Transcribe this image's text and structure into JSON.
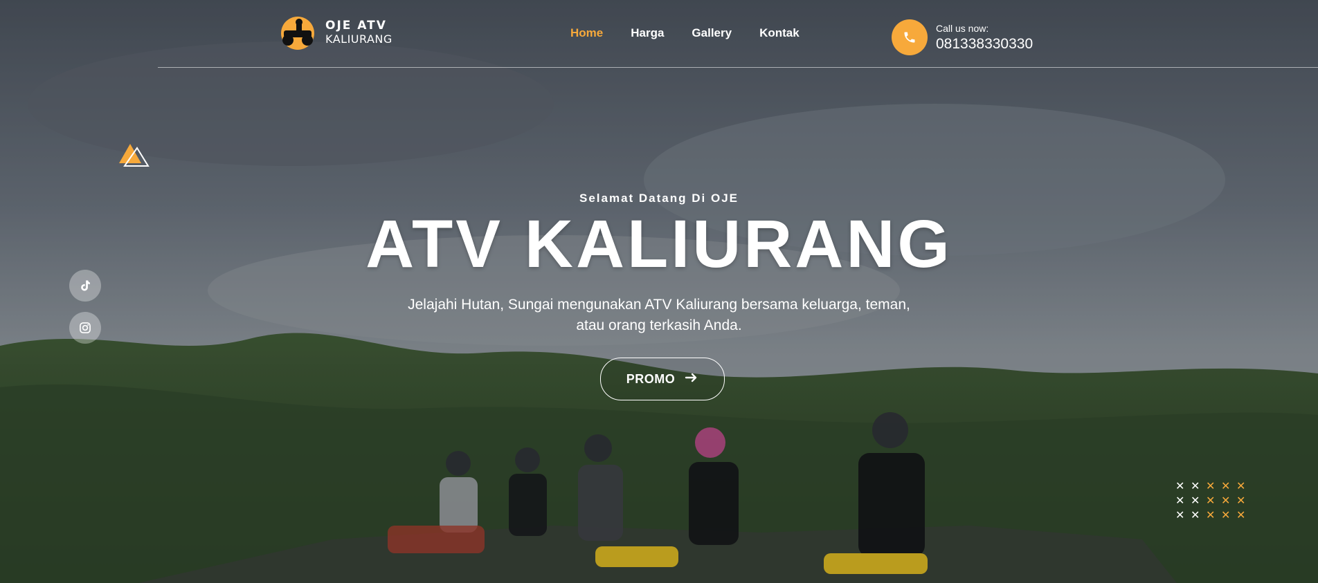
{
  "brand": {
    "name": "OJE ATV",
    "sub": "KALIURANG"
  },
  "nav": {
    "items": [
      {
        "label": "Home",
        "active": true
      },
      {
        "label": "Harga",
        "active": false
      },
      {
        "label": "Gallery",
        "active": false
      },
      {
        "label": "Kontak",
        "active": false
      }
    ]
  },
  "contact": {
    "label": "Call us now:",
    "phone": "081338330330",
    "icon": "phone-icon"
  },
  "socials": [
    {
      "icon": "tiktok-icon"
    },
    {
      "icon": "instagram-icon"
    }
  ],
  "hero": {
    "eyebrow": "Selamat Datang Di OJE",
    "title": "ATV KALIURANG",
    "subtitle": "Jelajahi Hutan, Sungai mengunakan ATV Kaliurang bersama keluarga, teman, atau orang terkasih Anda.",
    "cta": "PROMO"
  },
  "colors": {
    "accent": "#f7a93b",
    "text": "#ffffff"
  }
}
